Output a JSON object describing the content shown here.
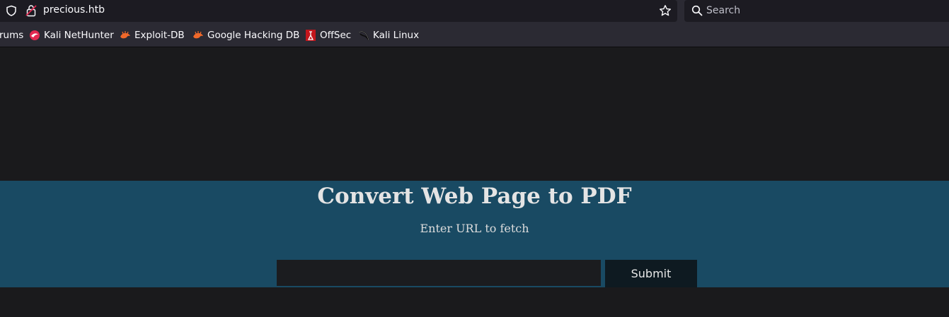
{
  "browser": {
    "url": "precious.htb",
    "search_placeholder": "Search",
    "bookmarks": [
      {
        "label": "rums",
        "icon": "none"
      },
      {
        "label": "Kali NetHunter",
        "icon": "kali-nethunter-icon"
      },
      {
        "label": "Exploit-DB",
        "icon": "exploit-db-icon"
      },
      {
        "label": "Google Hacking DB",
        "icon": "exploit-db-icon"
      },
      {
        "label": "OffSec",
        "icon": "offsec-icon"
      },
      {
        "label": "Kali Linux",
        "icon": "kali-dragon-icon"
      }
    ]
  },
  "page": {
    "title": "Convert Web Page to PDF",
    "subtitle": "Enter URL to fetch",
    "url_input_value": "",
    "submit_label": "Submit",
    "colors": {
      "hero_background": "#194a63",
      "page_background": "#1a1a1c",
      "submit_background": "#0e1a21"
    }
  }
}
